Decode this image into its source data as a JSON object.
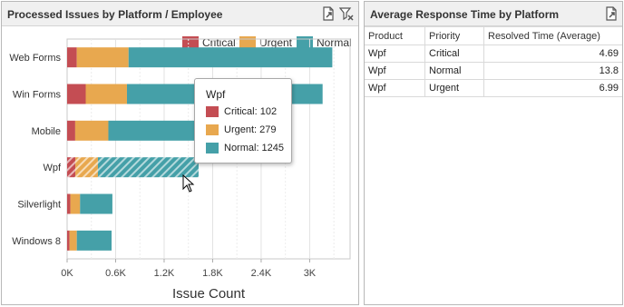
{
  "left_panel": {
    "title": "Processed Issues by Platform / Employee",
    "export_icon": "export-icon",
    "clear_filter_icon": "clear-filter-icon"
  },
  "right_panel": {
    "title": "Average Response Time by Platform",
    "export_icon": "export-icon"
  },
  "legend": {
    "critical": "Critical",
    "urgent": "Urgent",
    "normal": "Normal"
  },
  "colors": {
    "critical": "#c44d53",
    "urgent": "#e8a84f",
    "normal": "#45a0a8"
  },
  "tooltip": {
    "title": "Wpf",
    "rows": [
      "Critical: 102",
      "Urgent: 279",
      "Normal: 1245"
    ]
  },
  "chart_data": {
    "type": "bar",
    "orientation": "horizontal",
    "stacked": true,
    "categories": [
      "Web Forms",
      "Win Forms",
      "Mobile",
      "Wpf",
      "Silverlight",
      "Windows 8"
    ],
    "series": [
      {
        "name": "Critical",
        "values": [
          120,
          230,
          100,
          102,
          40,
          30
        ]
      },
      {
        "name": "Urgent",
        "values": [
          640,
          510,
          410,
          279,
          120,
          90
        ]
      },
      {
        "name": "Normal",
        "values": [
          2520,
          2420,
          1900,
          1245,
          400,
          430
        ]
      }
    ],
    "highlighted_category": "Wpf",
    "xlabel": "Issue Count",
    "x_ticks": [
      "0K",
      "0.6K",
      "1.2K",
      "1.8K",
      "2.4K",
      "3K"
    ],
    "xlim": [
      0,
      3500
    ],
    "grid": true,
    "legend_position": "top-right"
  },
  "table": {
    "columns": [
      "Product",
      "Priority",
      "Resolved Time (Average)"
    ],
    "rows": [
      [
        "Wpf",
        "Critical",
        "4.69"
      ],
      [
        "Wpf",
        "Normal",
        "13.8"
      ],
      [
        "Wpf",
        "Urgent",
        "6.99"
      ]
    ]
  }
}
